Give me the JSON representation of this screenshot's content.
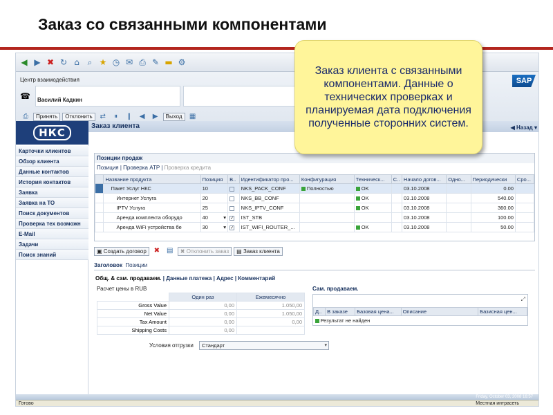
{
  "slide": {
    "title": "Заказ со связанными компонентами"
  },
  "callout": {
    "text": "Заказ клиента с связанными компонентами. Данные о технических проверках и планируемая дата подключения полученные сторонних систем."
  },
  "header": {
    "section_label": "Центр взаимодействия",
    "user_name": "Василий Кадкин",
    "buttons": [
      "Принять",
      "Отклонить",
      "Выход"
    ],
    "sap_logo": "SAP"
  },
  "sidebar": {
    "logo": "НКС",
    "items": [
      "Карточки клиентов",
      "Обзор клиента",
      "Данные контактов",
      "История контактов",
      "Заявка",
      "Заявка на ТО",
      "Поиск документов",
      "Проверка тех возможн",
      "E-Mail",
      "Задачи",
      "Поиск знаний"
    ]
  },
  "main": {
    "title": "Заказ клиента",
    "back_label": "Назад"
  },
  "positions": {
    "panel_title": "Позиции продаж",
    "subtabs": [
      "Позиция",
      "Проверка ATP",
      "Проверка кредита"
    ],
    "columns": [
      "Название продукта",
      "Позиция",
      "В..",
      "Идентификатор про...",
      "Конфигурация",
      "Техническ...",
      "С..",
      "Начало догов...",
      "Одно...",
      "Периодически",
      "Сро..."
    ],
    "rows": [
      {
        "name": "Пакет Услуг НКС",
        "pos": "10",
        "checked": "",
        "id": "NKS_PACK_CONF",
        "config": "Полностью",
        "tech": "OK",
        "start": "03.10.2008",
        "periodic": "0.00"
      },
      {
        "name": "Интернет Услуга",
        "pos": "20",
        "checked": "",
        "id": "NKS_BB_CONF",
        "config": "",
        "tech": "OK",
        "start": "03.10.2008",
        "periodic": "540.00"
      },
      {
        "name": "IPTV Услуга",
        "pos": "25",
        "checked": "",
        "id": "NKS_IPTV_CONF",
        "config": "",
        "tech": "OK",
        "start": "03.10.2008",
        "periodic": "360.00"
      },
      {
        "name": "Аренда комплекта оборудо",
        "pos": "40",
        "checked": "✓",
        "id": "IST_STB",
        "config": "",
        "tech": "",
        "start": "03.10.2008",
        "periodic": "100.00"
      },
      {
        "name": "Аренда WiFi устройства бе",
        "pos": "30",
        "checked": "✓",
        "id": "IST_WIFI_ROUTER_...",
        "config": "",
        "tech": "OK",
        "start": "03.10.2008",
        "periodic": "50.00"
      }
    ]
  },
  "actions": {
    "create_contract": "Создать договор",
    "reject_order": "Отклонить заказ",
    "client_order": "Заказ клиента"
  },
  "detail_tabs": {
    "tab1": "Заголовок",
    "tab2": "Позиции",
    "subtab1": "Общ. & сам. продаваем.",
    "subtab2": "Данные платежа",
    "subtab3": "Адрес",
    "subtab4": "Комментарий"
  },
  "pricing": {
    "label": "Расчет цены в RUB",
    "col_once": "Один раз",
    "col_monthly": "Ежемесячно",
    "rows": [
      {
        "label": "Gross Value",
        "once": "0,00",
        "monthly": "1.050,00"
      },
      {
        "label": "Net Value",
        "once": "0,00",
        "monthly": "1.050,00"
      },
      {
        "label": "Tax Amount",
        "once": "0,00",
        "monthly": "0,00"
      },
      {
        "label": "Shipping Costs",
        "once": "0,00",
        "monthly": ""
      }
    ],
    "shipping_label": "Условия отгрузки",
    "shipping_value": "Стандарт"
  },
  "self_sold": {
    "label": "Сам. продаваем.",
    "columns": [
      "Д..",
      "В заказе",
      "Базовая цена...",
      "Описание",
      "Базисная цен..."
    ],
    "result": "Результат не найден"
  },
  "status": {
    "left": "Готово",
    "right": "Местная интрасеть",
    "date": "Friday, October 03, 2008 16:57"
  },
  "colors": {
    "accent_red": "#b3261e",
    "nav_blue": "#17315e",
    "callout_yellow": "#fff59a"
  }
}
